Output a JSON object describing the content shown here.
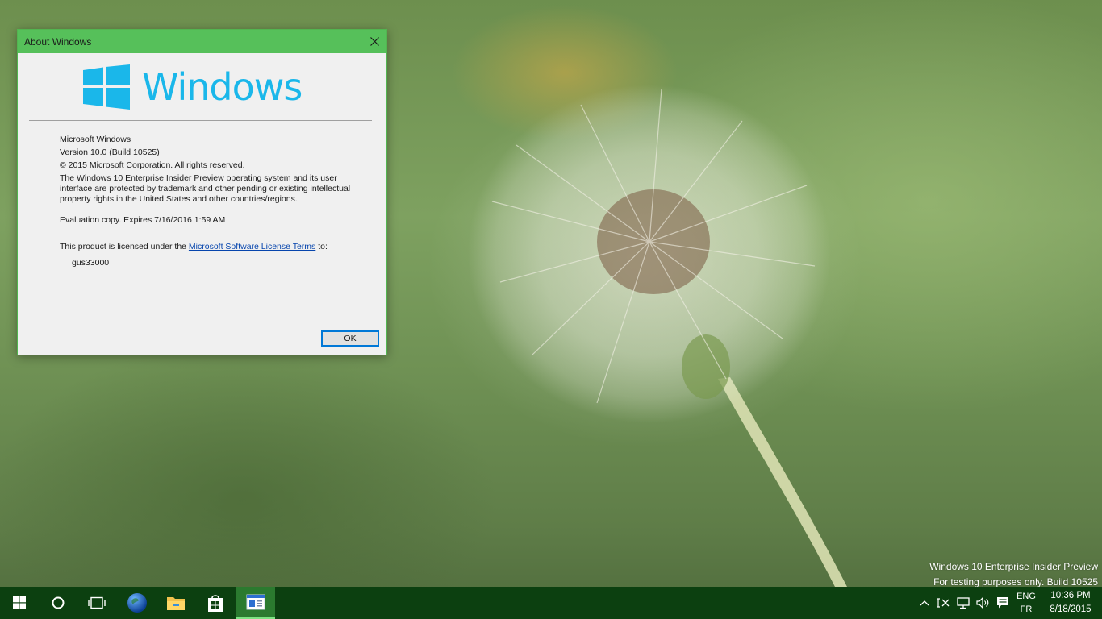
{
  "dialog": {
    "title": "About Windows",
    "logo_text": "Windows",
    "product_name": "Microsoft Windows",
    "version": "Version 10.0 (Build 10525)",
    "copyright": "© 2015 Microsoft Corporation. All rights reserved.",
    "description": "The Windows 10 Enterprise Insider Preview operating system and its user interface are protected by trademark and other pending or existing intellectual property rights in the United States and other countries/regions.",
    "evaluation": "Evaluation copy. Expires 7/16/2016 1:59 AM",
    "license_prefix": "This product is licensed under the ",
    "license_link": "Microsoft Software License Terms",
    "license_suffix": " to:",
    "licensee": "gus33000",
    "ok_label": "OK",
    "accent_color": "#56c05a",
    "logo_color": "#1ab7ea"
  },
  "watermark": {
    "line1": "Windows 10 Enterprise Insider Preview",
    "line2": "For testing purposes only. Build 10525"
  },
  "taskbar": {
    "color": "#0c4010",
    "items": [
      {
        "icon": "start-windows-icon"
      },
      {
        "icon": "cortana-circle-icon"
      },
      {
        "icon": "task-view-icon"
      },
      {
        "icon": "edge-globe-icon"
      },
      {
        "icon": "file-explorer-icon"
      },
      {
        "icon": "store-bag-icon"
      },
      {
        "icon": "winver-app-icon",
        "active": true
      }
    ],
    "tray": {
      "icons": [
        "show-hidden-chevron-icon",
        "input-indicator-icon",
        "network-icon",
        "volume-icon",
        "action-center-icon"
      ],
      "lang_top": "ENG",
      "lang_bottom": "FR",
      "time": "10:36 PM",
      "date": "8/18/2015"
    }
  }
}
